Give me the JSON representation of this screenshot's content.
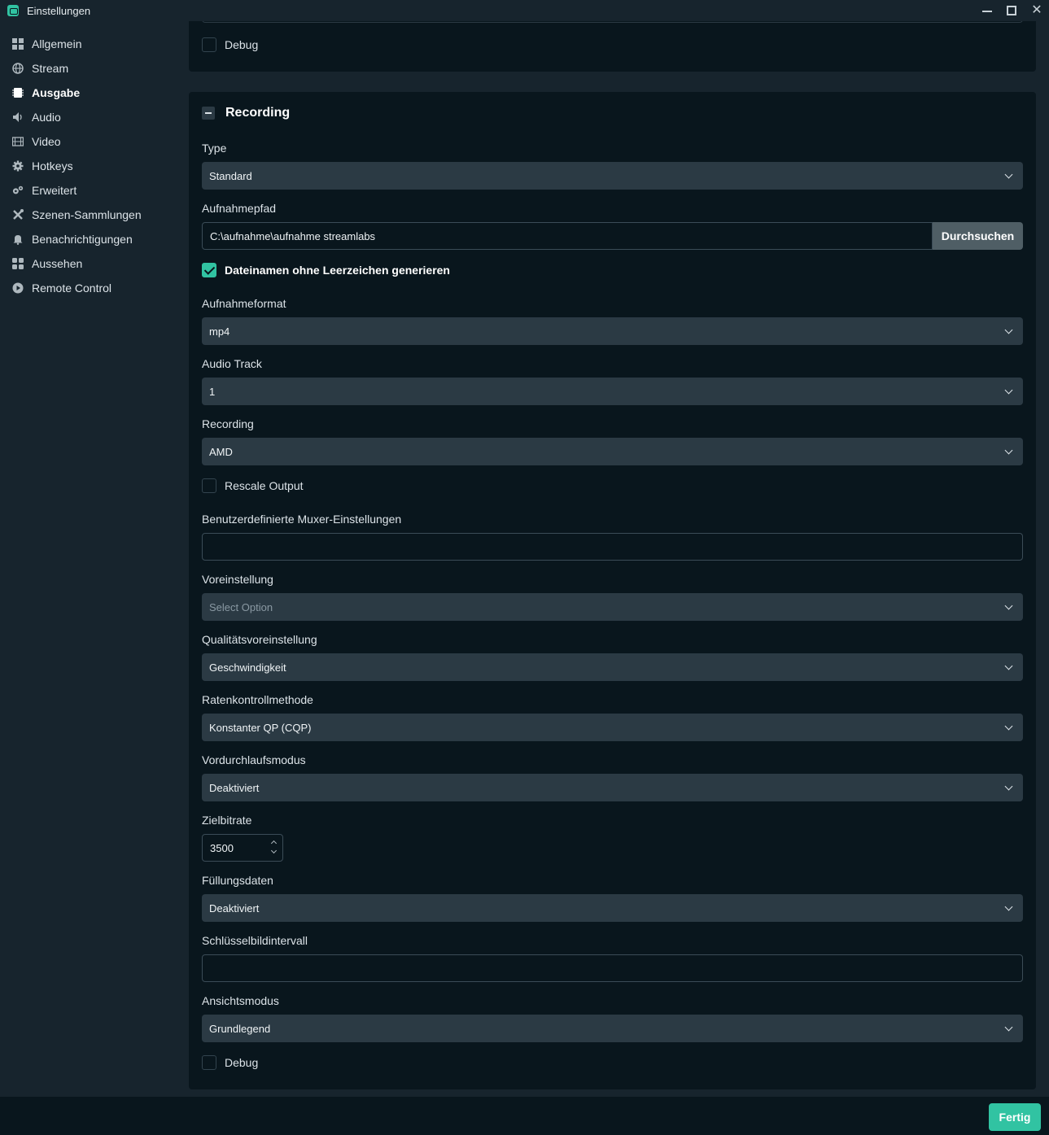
{
  "window": {
    "title": "Einstellungen",
    "controls": [
      "minimize",
      "maximize",
      "close"
    ]
  },
  "sidebar": {
    "items": [
      {
        "label": "Allgemein",
        "icon": "grid-icon",
        "active": false
      },
      {
        "label": "Stream",
        "icon": "globe-icon",
        "active": false
      },
      {
        "label": "Ausgabe",
        "icon": "chip-icon",
        "active": true
      },
      {
        "label": "Audio",
        "icon": "speaker-icon",
        "active": false
      },
      {
        "label": "Video",
        "icon": "film-icon",
        "active": false
      },
      {
        "label": "Hotkeys",
        "icon": "gear-icon",
        "active": false
      },
      {
        "label": "Erweitert",
        "icon": "gears-icon",
        "active": false
      },
      {
        "label": "Szenen-Sammlungen",
        "icon": "tools-icon",
        "active": false
      },
      {
        "label": "Benachrichtigungen",
        "icon": "bell-icon",
        "active": false
      },
      {
        "label": "Aussehen",
        "icon": "blocks-icon",
        "active": false
      },
      {
        "label": "Remote Control",
        "icon": "play-circle-icon",
        "active": false
      }
    ]
  },
  "streaming_section": {
    "debug_label": "Debug",
    "debug_checked": false
  },
  "recording": {
    "title": "Recording",
    "type": {
      "label": "Type",
      "value": "Standard"
    },
    "path": {
      "label": "Aufnahmepfad",
      "value": "C:\\aufnahme\\aufnahme streamlabs",
      "browse_label": "Durchsuchen"
    },
    "no_spaces": {
      "label": "Dateinamen ohne Leerzeichen generieren",
      "checked": true
    },
    "format": {
      "label": "Aufnahmeformat",
      "value": "mp4"
    },
    "audio_track": {
      "label": "Audio Track",
      "value": "1"
    },
    "encoder": {
      "label": "Recording",
      "value": "AMD"
    },
    "rescale": {
      "label": "Rescale Output",
      "checked": false
    },
    "muxer": {
      "label": "Benutzerdefinierte Muxer-Einstellungen",
      "value": ""
    },
    "preset": {
      "label": "Voreinstellung",
      "placeholder": "Select Option"
    },
    "quality_preset": {
      "label": "Qualitätsvoreinstellung",
      "value": "Geschwindigkeit"
    },
    "rate_control": {
      "label": "Ratenkontrollmethode",
      "value": "Konstanter QP (CQP)"
    },
    "prepass": {
      "label": "Vordurchlaufsmodus",
      "value": "Deaktiviert"
    },
    "target_bitrate": {
      "label": "Zielbitrate",
      "value": "3500"
    },
    "filler_data": {
      "label": "Füllungsdaten",
      "value": "Deaktiviert"
    },
    "keyframe_interval": {
      "label": "Schlüsselbildintervall",
      "value": ""
    },
    "view_mode": {
      "label": "Ansichtsmodus",
      "value": "Grundlegend"
    },
    "debug": {
      "label": "Debug",
      "checked": false
    }
  },
  "footer": {
    "done_label": "Fertig"
  },
  "colors": {
    "accent": "#31c3a2",
    "card_bg": "#09161d",
    "page_bg": "#17242d",
    "select_bg": "#2b3a44"
  }
}
